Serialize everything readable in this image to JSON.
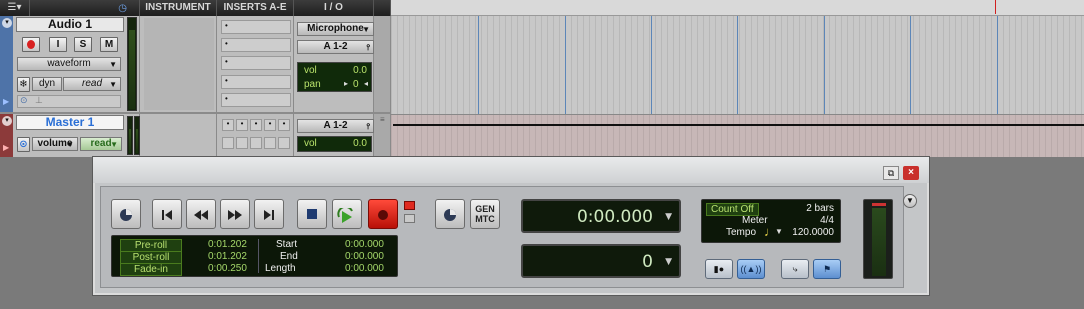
{
  "columns": {
    "instrument": "INSTRUMENT",
    "inserts": "INSERTS A-E",
    "io": "I / O"
  },
  "track_audio": {
    "name": "Audio 1",
    "rec": "",
    "input": "I",
    "solo": "S",
    "mute": "M",
    "view": "waveform",
    "playlist": "dyn",
    "automation": "read",
    "input_source": "Microphone",
    "output": "A 1-2",
    "vol_label": "vol",
    "vol_value": "0.0",
    "pan_label": "pan",
    "pan_value": "0",
    "insert_slots": [
      "•",
      "•",
      "•",
      "•",
      "•"
    ]
  },
  "track_master": {
    "name": "Master 1",
    "view": "volume",
    "automation": "read",
    "output": "A 1-2",
    "vol_label": "vol",
    "vol_value": "0.0"
  },
  "transport": {
    "gen_label": "GEN\nMTC",
    "counter_main": "0:00.000",
    "counter_sub": "0",
    "preroll_label": "Pre-roll",
    "preroll_value": "0:01.202",
    "postroll_label": "Post-roll",
    "postroll_value": "0:01.202",
    "fadein_label": "Fade-in",
    "fadein_value": "0:00.250",
    "start_label": "Start",
    "start_value": "0:00.000",
    "end_label": "End",
    "end_value": "0:00.000",
    "length_label": "Length",
    "length_value": "0:00.000",
    "count_off_label": "Count Off",
    "count_off_value": "2 bars",
    "meter_label": "Meter",
    "meter_value": "4/4",
    "tempo_label": "Tempo",
    "tempo_value": "120.0000"
  },
  "colors": {
    "accent_blue": "#2a6fd6",
    "record_red": "#d82020",
    "display_green": "#a5d86a"
  }
}
